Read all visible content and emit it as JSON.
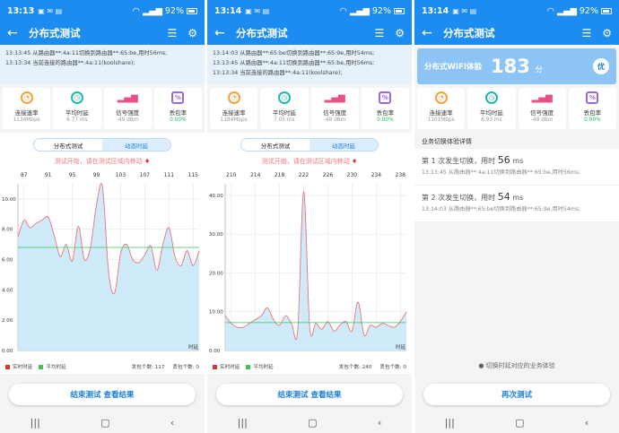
{
  "colors": {
    "primary": "#1d8cf0",
    "realtime": "#e03030",
    "average": "#38c758"
  },
  "panels": [
    {
      "status_time": "13:13",
      "battery": "92%",
      "title": "分布式测试",
      "log": [
        "13:13:45 从路由器**:4a:11切换到路由器**:65:be,用时56ms;",
        "13:13:34 当前连接的路由器**:4a:11(koolshare);"
      ],
      "metrics": [
        {
          "label": "连接速率",
          "value": "1134Mbps",
          "icon": "gauge-icon"
        },
        {
          "label": "平均时延",
          "value": "6.77 ms",
          "icon": "timer-icon"
        },
        {
          "label": "信号强度",
          "value": "-49 dBm",
          "icon": "signal-bars-icon"
        },
        {
          "label": "丢包率",
          "value": "0.00%",
          "icon": "percent-icon"
        }
      ],
      "seg": [
        "分布式测试",
        "动态时延"
      ],
      "hint": "测试开始，请在测试区域内移动",
      "legend": {
        "realtime": "实时时延",
        "average": "平均时延",
        "sent": "发包个数: 117",
        "lost": "丢包个数: 0"
      },
      "button": "结束测试  查看结果"
    },
    {
      "status_time": "13:14",
      "battery": "92%",
      "title": "分布式测试",
      "log": [
        "13:14:03 从路由器**:65:be切换到路由器**:65:9e,用时54ms;",
        "13:13:45 从路由器**:4a:11切换到路由器**:65:be,用时56ms;",
        "13:13:34 当前连接的路由器**:4a:11(koolshare);"
      ],
      "metrics": [
        {
          "label": "连接速率",
          "value": "1184Mbps",
          "icon": "gauge-icon"
        },
        {
          "label": "平均时延",
          "value": "7.05 ms",
          "icon": "timer-icon"
        },
        {
          "label": "信号强度",
          "value": "-48 dBm",
          "icon": "signal-bars-icon"
        },
        {
          "label": "丢包率",
          "value": "0.00%",
          "icon": "percent-icon"
        }
      ],
      "seg": [
        "分布式测试",
        "动态时延"
      ],
      "hint": "测试开始，请在测试区域内移动",
      "legend": {
        "realtime": "实时时延",
        "average": "平均时延",
        "sent": "发包个数: 240",
        "lost": "丢包个数: 0"
      },
      "button": "结束测试  查看结果"
    },
    {
      "status_time": "13:14",
      "battery": "92%",
      "title": "分布式测试",
      "score_label": "分布式WIFI体验",
      "score": "183",
      "score_unit": "分",
      "grade": "优",
      "metrics": [
        {
          "label": "连接速率",
          "value": "1101Mbps",
          "icon": "gauge-icon"
        },
        {
          "label": "平均时延",
          "value": "6.93 ms",
          "icon": "timer-icon"
        },
        {
          "label": "信号强度",
          "value": "-48 dBm",
          "icon": "signal-bars-icon"
        },
        {
          "label": "丢包率",
          "value": "0.00%",
          "icon": "percent-icon"
        }
      ],
      "section": "业务切换体验详情",
      "switches": [
        {
          "prefix": "第 1 次发生切换，用时",
          "ms": "56",
          "unit": "ms",
          "detail": "13:13:45 从路由器**:4a:11切换到路由器**:65:be,用时56ms;"
        },
        {
          "prefix": "第 2 次发生切换，用时",
          "ms": "54",
          "unit": "ms",
          "detail": "13:14:03 从路由器**:65:be切换到路由器**:65:9e,用时54ms;"
        }
      ],
      "note": "切换时延对应的业务体验",
      "button": "再次测试"
    }
  ],
  "chart_data": [
    {
      "type": "line",
      "x_ticks": [
        "87",
        "91",
        "95",
        "99",
        "103",
        "107",
        "111",
        "115"
      ],
      "y_ticks": [
        "0.00",
        "2.00",
        "4.00",
        "6.00",
        "8.00",
        "10.00"
      ],
      "xlabel": "时延",
      "ylim": [
        0,
        11
      ],
      "xlim": [
        86,
        116
      ],
      "average": 6.8,
      "series": [
        {
          "name": "实时时延",
          "x": [
            86,
            87,
            88,
            89,
            90,
            91,
            92,
            93,
            94,
            95,
            96,
            97,
            98,
            99,
            100,
            101,
            102,
            103,
            104,
            105,
            106,
            107,
            108,
            109,
            110,
            111,
            112,
            113,
            114,
            115,
            116
          ],
          "y": [
            7.5,
            8.6,
            8.1,
            8.4,
            8.6,
            8.8,
            7.6,
            6.2,
            7.0,
            5.9,
            8.2,
            6.0,
            6.8,
            9.6,
            10.8,
            5.2,
            3.8,
            6.4,
            7.0,
            6.0,
            5.8,
            6.3,
            6.9,
            5.3,
            7.0,
            8.1,
            6.2,
            5.6,
            6.6,
            5.6,
            6.6
          ]
        }
      ]
    },
    {
      "type": "line",
      "x_ticks": [
        "210",
        "214",
        "218",
        "222",
        "226",
        "230",
        "234",
        "238"
      ],
      "y_ticks": [
        "0.00",
        "10.00",
        "20.00",
        "30.00",
        "40.00"
      ],
      "xlabel": "时延",
      "ylim": [
        0,
        43
      ],
      "xlim": [
        209,
        239
      ],
      "average": 7.2,
      "series": [
        {
          "name": "实时时延",
          "x": [
            209,
            210,
            211,
            212,
            213,
            214,
            215,
            216,
            217,
            218,
            219,
            220,
            221,
            222,
            223,
            224,
            225,
            226,
            227,
            228,
            229,
            230,
            231,
            232,
            233,
            234,
            235,
            236,
            237,
            238,
            239
          ],
          "y": [
            9,
            7,
            6,
            6,
            7,
            8,
            9,
            11,
            8,
            6.5,
            9,
            7,
            5,
            41,
            6,
            7,
            5.5,
            7.5,
            5,
            6.5,
            7.5,
            5,
            12.5,
            4,
            6.5,
            6,
            7,
            6.5,
            6,
            7.5,
            10
          ]
        }
      ]
    }
  ]
}
